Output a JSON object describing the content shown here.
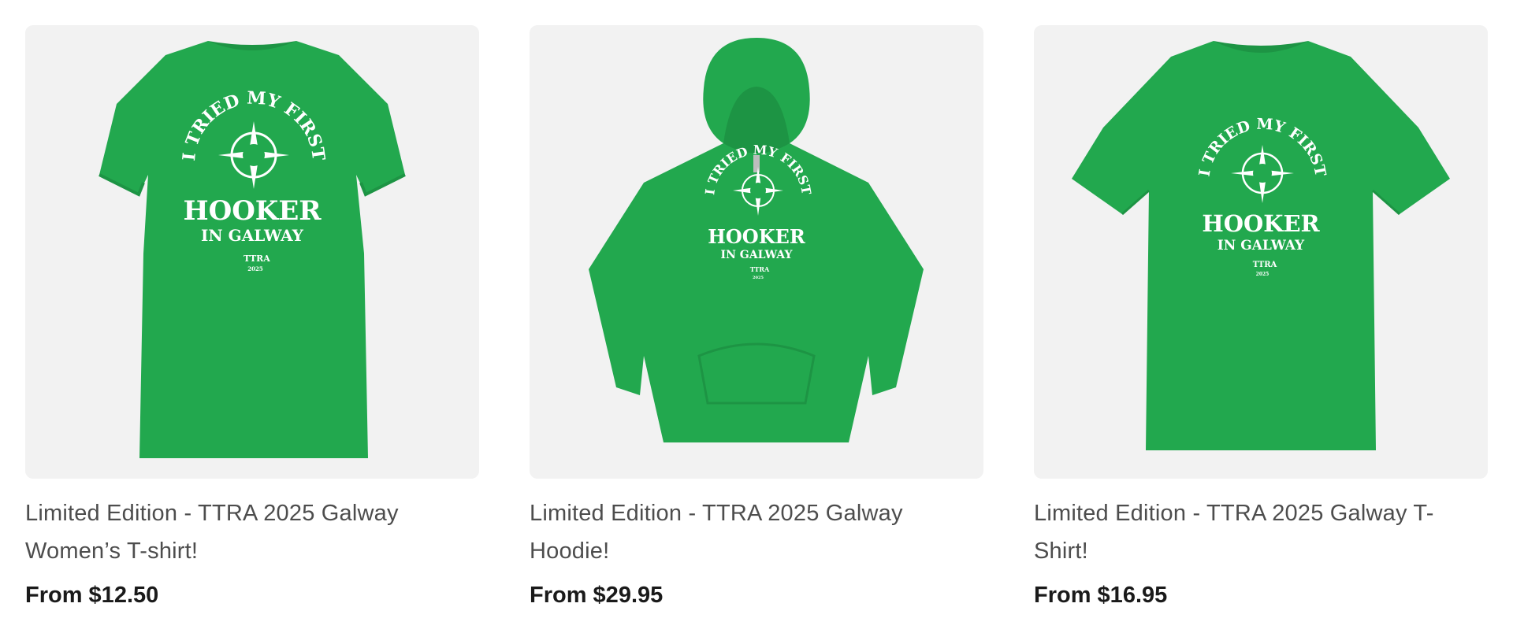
{
  "products": [
    {
      "title": "Limited Edition - TTRA 2025 Galway Women’s T-shirt!",
      "price": "From $12.50",
      "garment": "womens-tshirt",
      "print": {
        "arc_text": "I TRIED MY FIRST",
        "main": "HOOKER",
        "sub": "IN GALWAY",
        "brand": "TTRA",
        "year": "2025"
      }
    },
    {
      "title": "Limited Edition - TTRA 2025 Galway Hoodie!",
      "price": "From $29.95",
      "garment": "hoodie",
      "print": {
        "arc_text": "I TRIED MY FIRST",
        "main": "HOOKER",
        "sub": "IN GALWAY",
        "brand": "TTRA",
        "year": "2025"
      }
    },
    {
      "title": "Limited Edition - TTRA 2025 Galway T-Shirt!",
      "price": "From $16.95",
      "garment": "unisex-tshirt",
      "print": {
        "arc_text": "I TRIED MY FIRST",
        "main": "HOOKER",
        "sub": "IN GALWAY",
        "brand": "TTRA",
        "year": "2025"
      }
    }
  ],
  "colors": {
    "garment_green": "#22a84e",
    "garment_shadow": "#1d9444",
    "image_bg": "#f2f2f2"
  }
}
